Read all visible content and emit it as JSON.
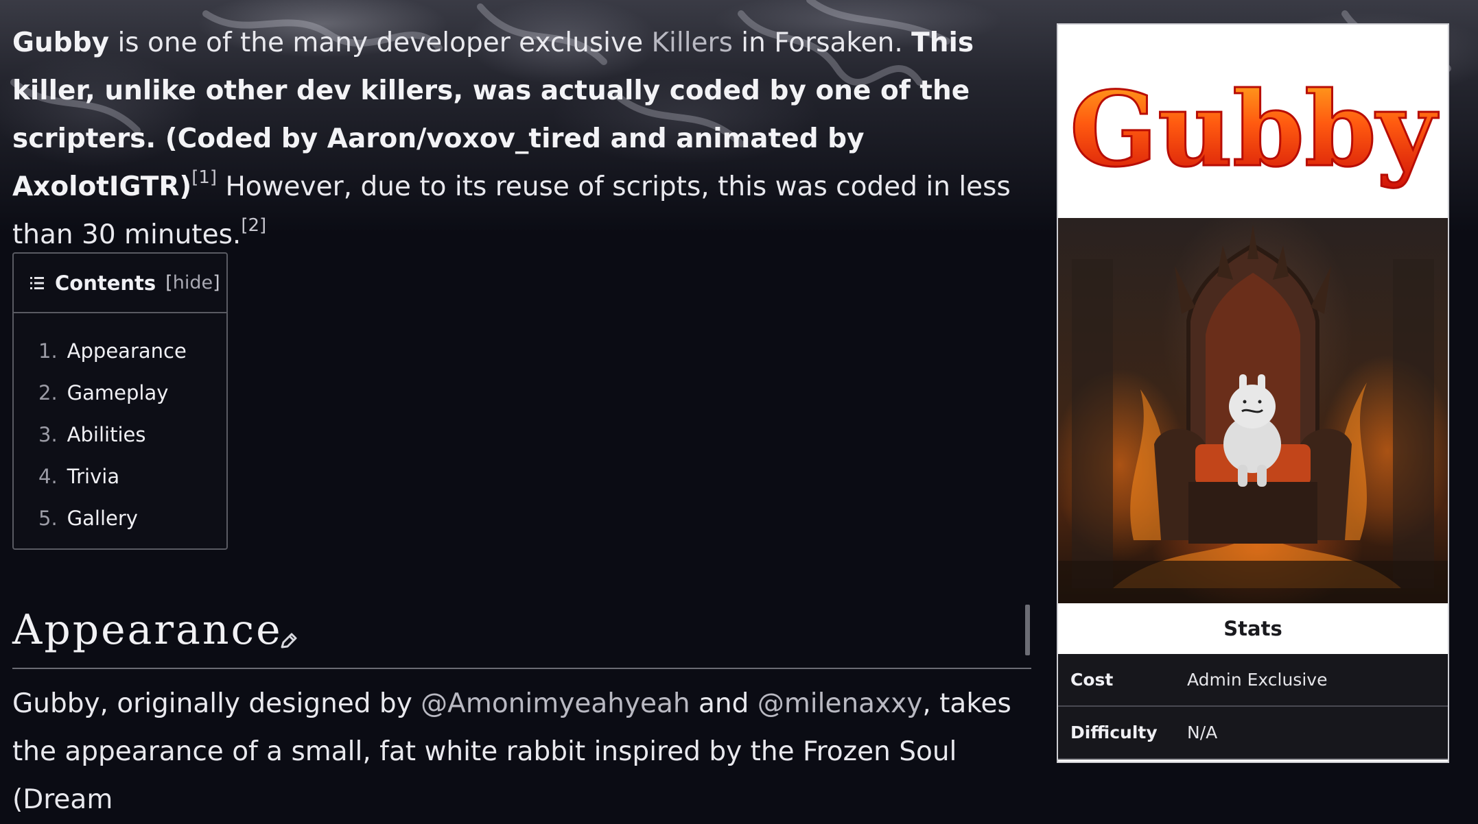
{
  "intro": {
    "subject": "Gubby",
    "text_1": " is one of the many developer exclusive ",
    "killers_link": "Killers",
    "text_2": " in Forsaken. ",
    "bold_text": "This killer, unlike other dev killers, was actually coded by one of the scripters. (Coded by Aaron/voxov_tired and animated by AxolotIGTR)",
    "ref_1": "[1]",
    "text_3": " However, due to its reuse of scripts, this was coded in less than 30 minutes.",
    "ref_2": "[2]"
  },
  "toc": {
    "title": "Contents",
    "hide_open": "[",
    "hide_label": "hide",
    "hide_close": "]",
    "items": [
      {
        "num": "1.",
        "label": "Appearance"
      },
      {
        "num": "2.",
        "label": "Gameplay"
      },
      {
        "num": "3.",
        "label": "Abilities"
      },
      {
        "num": "4.",
        "label": "Trivia"
      },
      {
        "num": "5.",
        "label": "Gallery"
      }
    ]
  },
  "appearance": {
    "heading": "Appearance",
    "text_1": "Gubby, originally designed by ",
    "designer_1": "@Amonimyeahyeah",
    "text_2": " and ",
    "designer_2": "@milenaxxy",
    "text_3": ", takes the appearance of a small, fat white rabbit inspired by the Frozen Soul (Dream"
  },
  "infobox": {
    "logo_text": "Gubby",
    "stats_title": "Stats",
    "rows": [
      {
        "label": "Cost",
        "value": "Admin Exclusive"
      },
      {
        "label": "Difficulty",
        "value": "N/A"
      }
    ]
  },
  "colors": {
    "page_bg": "#0b0c14",
    "link_text": "#b9b9c2",
    "logo_fire": "#e0280a",
    "infobox_stats_bg": "#17171c"
  }
}
